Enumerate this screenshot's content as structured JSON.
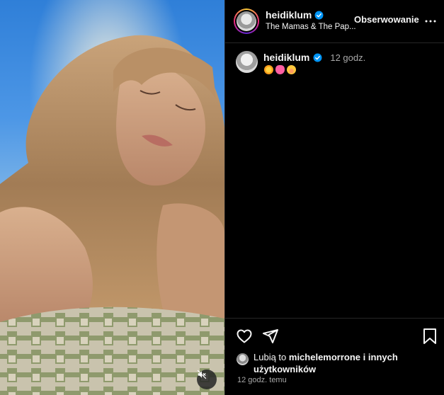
{
  "post": {
    "username": "heidiklum",
    "audio_track": "The Mamas & The Pap...",
    "follow_label": "Obserwowanie",
    "caption": {
      "username": "heidiklum",
      "time_ago": "12 godz.",
      "emojis": [
        "sun",
        "cat-face",
        "smiling-face"
      ]
    },
    "likes": {
      "prefix": "Lubią to",
      "first_liker": "michelemorrone",
      "connector": "i",
      "others": "innych użytkowników"
    },
    "timestamp": "12 godz. temu"
  },
  "icons": {
    "verified": "verified-badge-icon",
    "more": "more-options-icon",
    "like": "heart-icon",
    "share": "share-icon",
    "save": "bookmark-icon",
    "mute": "audio-muted-icon"
  },
  "colors": {
    "background": "#000000",
    "text": "#f5f5f5",
    "secondary_text": "#a8a8a8",
    "verified_blue": "#0095f6",
    "divider": "#262626"
  }
}
